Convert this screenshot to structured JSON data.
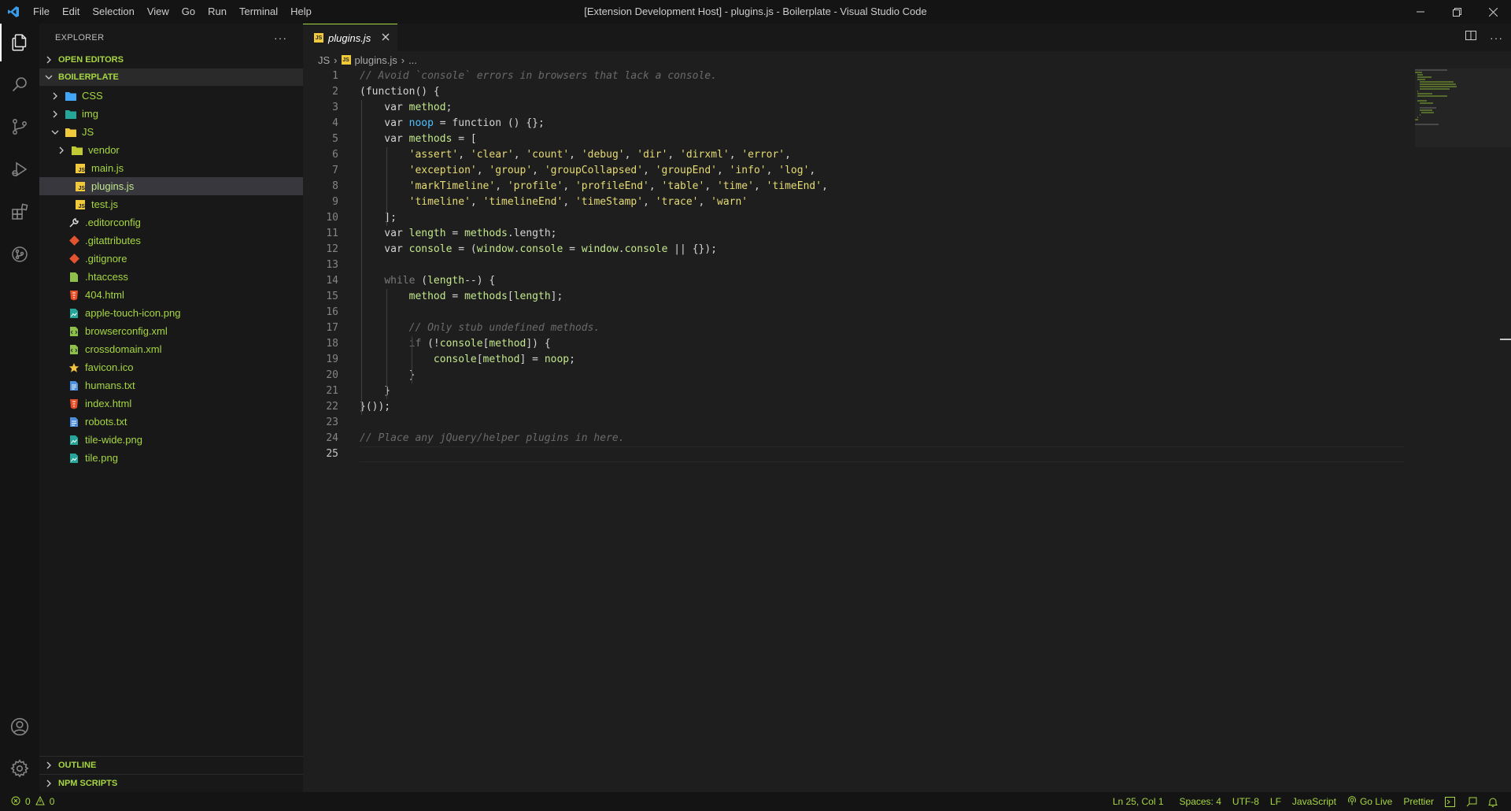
{
  "titlebar": {
    "menu": [
      "File",
      "Edit",
      "Selection",
      "View",
      "Go",
      "Run",
      "Terminal",
      "Help"
    ],
    "window_title": "[Extension Development Host] - plugins.js - Boilerplate - Visual Studio Code"
  },
  "activity_bar": {
    "items": [
      "explorer-icon",
      "search-icon",
      "source-control-icon",
      "run-debug-icon",
      "extensions-icon",
      "git-graph-icon"
    ],
    "bottom": [
      "accounts-icon",
      "manage-gear-icon"
    ]
  },
  "sidebar": {
    "title": "EXPLORER",
    "open_editors": "OPEN EDITORS",
    "project": "BOILERPLATE",
    "tree": [
      {
        "label": "CSS",
        "type": "folder",
        "depth": 1,
        "state": "collapsed"
      },
      {
        "label": "img",
        "type": "folder",
        "depth": 1,
        "state": "collapsed"
      },
      {
        "label": "JS",
        "type": "folder",
        "depth": 1,
        "state": "expanded"
      },
      {
        "label": "vendor",
        "type": "folder",
        "depth": 2,
        "state": "collapsed"
      },
      {
        "label": "main.js",
        "type": "js",
        "depth": 2
      },
      {
        "label": "plugins.js",
        "type": "js",
        "depth": 2,
        "selected": true
      },
      {
        "label": "test.js",
        "type": "js",
        "depth": 2
      },
      {
        "label": ".editorconfig",
        "type": "config",
        "depth": 1
      },
      {
        "label": ".gitattributes",
        "type": "git",
        "depth": 1
      },
      {
        "label": ".gitignore",
        "type": "git",
        "depth": 1
      },
      {
        "label": ".htaccess",
        "type": "htaccess",
        "depth": 1
      },
      {
        "label": "404.html",
        "type": "html",
        "depth": 1
      },
      {
        "label": "apple-touch-icon.png",
        "type": "image",
        "depth": 1
      },
      {
        "label": "browserconfig.xml",
        "type": "xml",
        "depth": 1
      },
      {
        "label": "crossdomain.xml",
        "type": "xml",
        "depth": 1
      },
      {
        "label": "favicon.ico",
        "type": "star",
        "depth": 1
      },
      {
        "label": "humans.txt",
        "type": "text",
        "depth": 1
      },
      {
        "label": "index.html",
        "type": "html",
        "depth": 1
      },
      {
        "label": "robots.txt",
        "type": "text",
        "depth": 1
      },
      {
        "label": "tile-wide.png",
        "type": "image",
        "depth": 1
      },
      {
        "label": "tile.png",
        "type": "image",
        "depth": 1
      }
    ],
    "outline": "OUTLINE",
    "npm_scripts": "NPM SCRIPTS"
  },
  "editor": {
    "tab": {
      "label": "plugins.js",
      "icon_text": "JS"
    },
    "breadcrumb": [
      "JS",
      "plugins.js",
      "..."
    ],
    "current_line": 25,
    "lines": [
      [
        [
          "c",
          "// Avoid `console` errors in browsers that lack a console."
        ]
      ],
      [
        [
          "t",
          "(function() {"
        ]
      ],
      [
        [
          "t",
          "    var "
        ],
        [
          "v",
          "method"
        ],
        [
          "t",
          ";"
        ]
      ],
      [
        [
          "t",
          "    var "
        ],
        [
          "b",
          "noop"
        ],
        [
          "t",
          " = function () {};"
        ]
      ],
      [
        [
          "t",
          "    var "
        ],
        [
          "v",
          "methods"
        ],
        [
          "t",
          " = ["
        ]
      ],
      [
        [
          "t",
          "        "
        ],
        [
          "s",
          "'assert'"
        ],
        [
          "t",
          ", "
        ],
        [
          "s",
          "'clear'"
        ],
        [
          "t",
          ", "
        ],
        [
          "s",
          "'count'"
        ],
        [
          "t",
          ", "
        ],
        [
          "s",
          "'debug'"
        ],
        [
          "t",
          ", "
        ],
        [
          "s",
          "'dir'"
        ],
        [
          "t",
          ", "
        ],
        [
          "s",
          "'dirxml'"
        ],
        [
          "t",
          ", "
        ],
        [
          "s",
          "'error'"
        ],
        [
          "t",
          ","
        ]
      ],
      [
        [
          "t",
          "        "
        ],
        [
          "s",
          "'exception'"
        ],
        [
          "t",
          ", "
        ],
        [
          "s",
          "'group'"
        ],
        [
          "t",
          ", "
        ],
        [
          "s",
          "'groupCollapsed'"
        ],
        [
          "t",
          ", "
        ],
        [
          "s",
          "'groupEnd'"
        ],
        [
          "t",
          ", "
        ],
        [
          "s",
          "'info'"
        ],
        [
          "t",
          ", "
        ],
        [
          "s",
          "'log'"
        ],
        [
          "t",
          ","
        ]
      ],
      [
        [
          "t",
          "        "
        ],
        [
          "s",
          "'markTimeline'"
        ],
        [
          "t",
          ", "
        ],
        [
          "s",
          "'profile'"
        ],
        [
          "t",
          ", "
        ],
        [
          "s",
          "'profileEnd'"
        ],
        [
          "t",
          ", "
        ],
        [
          "s",
          "'table'"
        ],
        [
          "t",
          ", "
        ],
        [
          "s",
          "'time'"
        ],
        [
          "t",
          ", "
        ],
        [
          "s",
          "'timeEnd'"
        ],
        [
          "t",
          ","
        ]
      ],
      [
        [
          "t",
          "        "
        ],
        [
          "s",
          "'timeline'"
        ],
        [
          "t",
          ", "
        ],
        [
          "s",
          "'timelineEnd'"
        ],
        [
          "t",
          ", "
        ],
        [
          "s",
          "'timeStamp'"
        ],
        [
          "t",
          ", "
        ],
        [
          "s",
          "'trace'"
        ],
        [
          "t",
          ", "
        ],
        [
          "s",
          "'warn'"
        ]
      ],
      [
        [
          "t",
          "    ];"
        ]
      ],
      [
        [
          "t",
          "    var "
        ],
        [
          "v",
          "length"
        ],
        [
          "t",
          " = "
        ],
        [
          "v",
          "methods"
        ],
        [
          "t",
          ".length;"
        ]
      ],
      [
        [
          "t",
          "    var "
        ],
        [
          "v",
          "console"
        ],
        [
          "t",
          " = ("
        ],
        [
          "v",
          "window"
        ],
        [
          "t",
          "."
        ],
        [
          "v",
          "console"
        ],
        [
          "t",
          " = "
        ],
        [
          "v",
          "window"
        ],
        [
          "t",
          "."
        ],
        [
          "v",
          "console"
        ],
        [
          "t",
          " || {});"
        ]
      ],
      [
        [
          "t",
          ""
        ]
      ],
      [
        [
          "t",
          "    "
        ],
        [
          "k",
          "while"
        ],
        [
          "t",
          " ("
        ],
        [
          "v",
          "length"
        ],
        [
          "t",
          "--) {"
        ]
      ],
      [
        [
          "t",
          "        "
        ],
        [
          "v",
          "method"
        ],
        [
          "t",
          " = "
        ],
        [
          "v",
          "methods"
        ],
        [
          "t",
          "["
        ],
        [
          "v",
          "length"
        ],
        [
          "t",
          "];"
        ]
      ],
      [
        [
          "t",
          ""
        ]
      ],
      [
        [
          "t",
          "        "
        ],
        [
          "c",
          "// Only stub undefined methods."
        ]
      ],
      [
        [
          "t",
          "        "
        ],
        [
          "k",
          "if"
        ],
        [
          "t",
          " (!"
        ],
        [
          "v",
          "console"
        ],
        [
          "t",
          "["
        ],
        [
          "v",
          "method"
        ],
        [
          "t",
          "]) {"
        ]
      ],
      [
        [
          "t",
          "            "
        ],
        [
          "v",
          "console"
        ],
        [
          "t",
          "["
        ],
        [
          "v",
          "method"
        ],
        [
          "t",
          "] = "
        ],
        [
          "v",
          "noop"
        ],
        [
          "t",
          ";"
        ]
      ],
      [
        [
          "t",
          "        }"
        ]
      ],
      [
        [
          "t",
          "    }"
        ]
      ],
      [
        [
          "t",
          "}());"
        ]
      ],
      [
        [
          "t",
          ""
        ]
      ],
      [
        [
          "c",
          "// Place any jQuery/helper plugins in here."
        ]
      ],
      [
        [
          "t",
          ""
        ]
      ]
    ]
  },
  "statusbar": {
    "errors": "0",
    "warnings": "0",
    "position": "Ln 25, Col 1",
    "spaces": "Spaces: 4",
    "encoding": "UTF-8",
    "eol": "LF",
    "language": "JavaScript",
    "go_live": "Go Live",
    "formatter": "Prettier"
  },
  "colors": {
    "accent": "#a6d641",
    "string": "#e6db74",
    "variable": "#c3e88d",
    "comment": "#6a6a6a",
    "keyword": "#7a7a7a",
    "blue_ident": "#4fc1ff"
  }
}
